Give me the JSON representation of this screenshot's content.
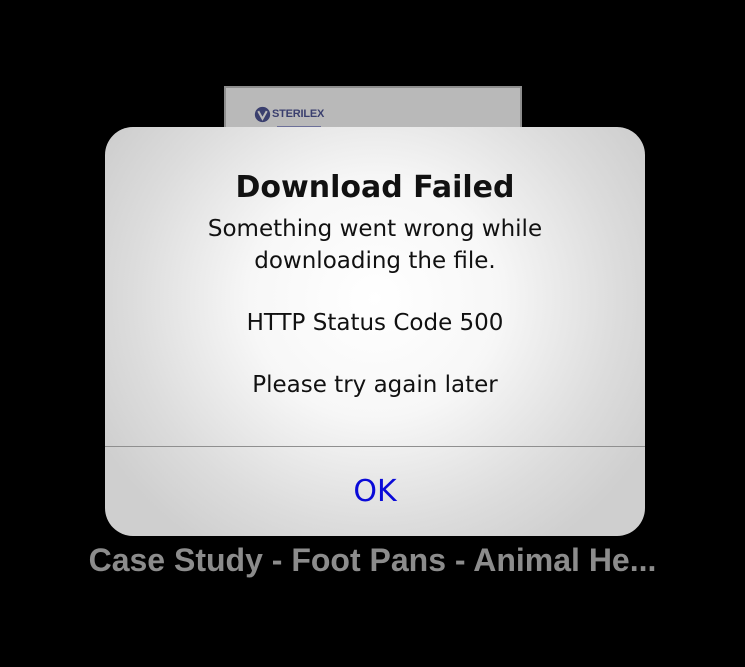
{
  "background_document": {
    "logo_text": "STERILEX",
    "caption": "Case Study - Foot Pans - Animal He..."
  },
  "alert": {
    "title": "Download Failed",
    "message_lines": [
      "Something went wrong while",
      "downloading the file.",
      "HTTP Status Code 500",
      "Please try again later"
    ],
    "ok_label": "OK"
  },
  "colors": {
    "screen_background": "#000000",
    "alert_button_text": "#0a0ad8",
    "caption_text": "#8c8c8c",
    "logo_text": "#3a3f6e"
  }
}
